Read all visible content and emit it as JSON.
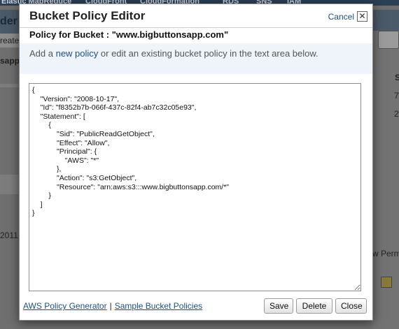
{
  "background": {
    "nav_tabs": [
      "Elastic MapReduce",
      "CloudFront",
      "CloudFormation",
      "RDS",
      "SNS",
      "IAM"
    ],
    "bar_fragment": "der",
    "fragments": {
      "create": "reate",
      "sapp": "sapp",
      "s_header": "S",
      "seven": "7",
      "two": "2",
      "year": "2011",
      "perm": "w Perm"
    }
  },
  "dialog": {
    "title": "Bucket Policy Editor",
    "cancel_label": "Cancel",
    "close_glyph": "✕",
    "policy_heading": "Policy for Bucket : \"www.bigbuttonsapp.com\"",
    "instruction_before": "Add a ",
    "instruction_link": "new policy",
    "instruction_after": " or edit an existing bucket policy in the text area below.",
    "policy_text": "{\n\t\"Version\": \"2008-10-17\",\n\t\"Id\": \"f8352b7b-066f-437c-82f4-ab7c32c05e93\",\n\t\"Statement\": [\n\t\t{\n\t\t\t\"Sid\": \"PublicReadGetObject\",\n\t\t\t\"Effect\": \"Allow\",\n\t\t\t\"Principal\": {\n\t\t\t\t\"AWS\": \"*\"\n\t\t\t},\n\t\t\t\"Action\": \"s3:GetObject\",\n\t\t\t\"Resource\": \"arn:aws:s3:::www.bigbuttonsapp.com/*\"\n\t\t}\n\t]\n}",
    "links": {
      "policy_generator": "AWS Policy Generator",
      "separator": "|",
      "sample_policies": "Sample Bucket Policies"
    },
    "buttons": {
      "save": "Save",
      "delete": "Delete",
      "close": "Close"
    }
  }
}
